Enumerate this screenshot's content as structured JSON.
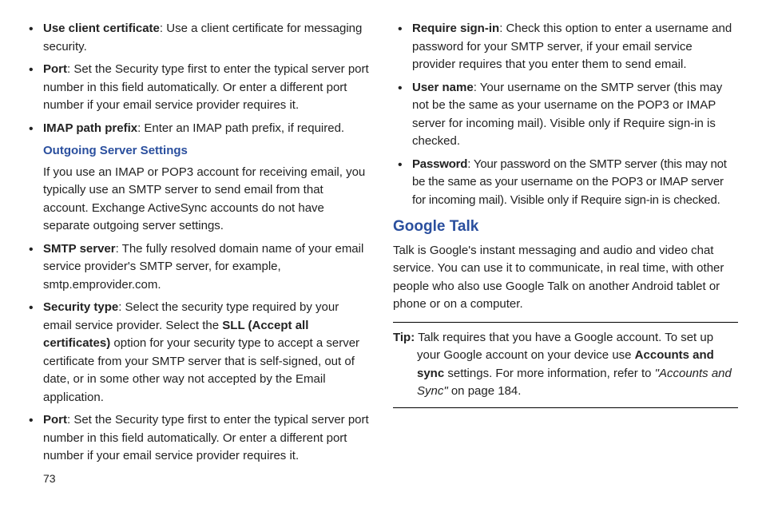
{
  "left": {
    "items_top": [
      {
        "term": "Use client certificate",
        "desc": ": Use a client certificate for messaging security."
      },
      {
        "term": "Port",
        "desc": ": Set the Security type first to enter the typical server port number in this field automatically. Or enter a different port number if your email service provider requires it."
      },
      {
        "term": "IMAP path prefix",
        "desc": ": Enter an IMAP path prefix, if required."
      }
    ],
    "outgoing_head": "Outgoing Server Settings",
    "outgoing_para": "If you use an IMAP or POP3 account for receiving email, you typically use an SMTP server to send email from that account. Exchange ActiveSync accounts do not have separate outgoing server settings.",
    "items_bottom": [
      {
        "term": "SMTP server",
        "desc": ": The fully resolved domain name of your email service provider's SMTP server, for example, smtp.emprovider.com."
      },
      {
        "term": "Security type",
        "desc_pre": ": Select the security type required by your email service provider. Select the ",
        "bold": "SLL (Accept all certificates)",
        "desc_post": " option for your security type to accept a server certificate from your SMTP server that is self-signed, out of date, or in some other way not accepted by the Email application."
      },
      {
        "term": "Port",
        "desc": ": Set the Security type first to enter the typical server port number in this field automatically. Or enter a different port number if your email service provider requires it."
      }
    ],
    "page_num": "73"
  },
  "right": {
    "items_top": [
      {
        "term": "Require sign-in",
        "desc": ": Check this option to enter a username and password for your SMTP server, if your email service provider requires that you enter them to send email."
      },
      {
        "term": "User name",
        "desc": ": Your username on the SMTP server (this may not be the same as your username on the POP3 or IMAP server for incoming mail). Visible only if Require sign-in is checked."
      },
      {
        "term": "Password",
        "desc": ": Your password on the SMTP server (this may not be the same as your username on the POP3 or IMAP server for incoming mail). Visible only if Require sign-in is checked."
      }
    ],
    "google_head": "Google Talk",
    "google_para": "Talk is Google's instant messaging and audio and video chat service. You can use it to communicate, in real time, with other people who also use Google Talk on another Android tablet or phone or on a computer.",
    "tip": {
      "label": "Tip:",
      "pre": " Talk requires that you have a Google account. To set up your Google account on your device use ",
      "bold1": "Accounts and sync",
      "mid": " settings. For more information, refer to ",
      "italic": "\"Accounts and Sync\" ",
      "post": " on page 184."
    }
  }
}
